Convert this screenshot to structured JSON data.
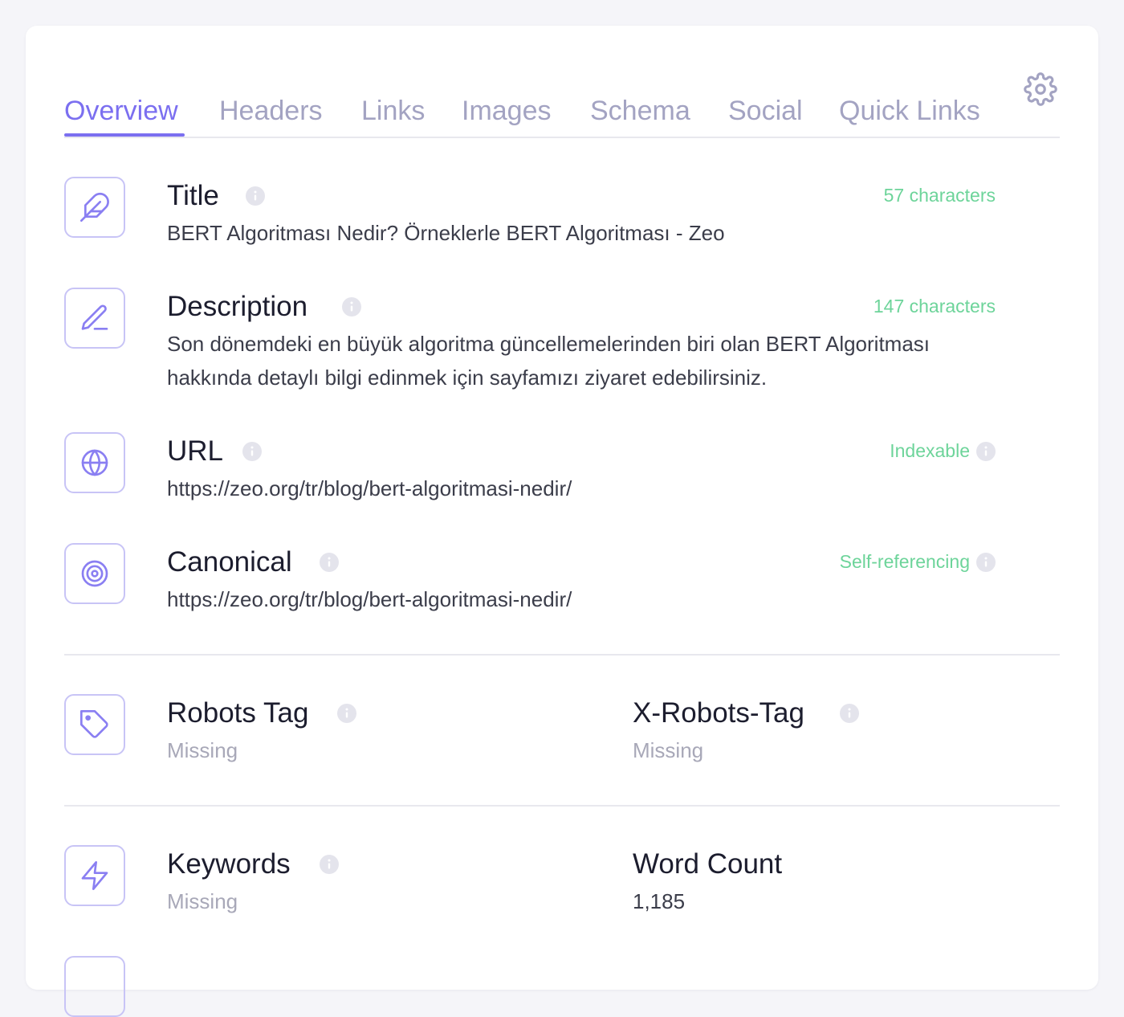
{
  "tabs": [
    {
      "label": "Overview",
      "active": true
    },
    {
      "label": "Headers"
    },
    {
      "label": "Links"
    },
    {
      "label": "Images"
    },
    {
      "label": "Schema"
    },
    {
      "label": "Social"
    },
    {
      "label": "Quick Links"
    }
  ],
  "settings_icon": "gear-icon",
  "colors": {
    "accent": "#7b6ff0",
    "tab_inactive": "#a3a3c2",
    "status_ok": "#6dd49a",
    "muted": "#a8a8b8"
  },
  "rows": {
    "title": {
      "label": "Title",
      "status": "57 characters",
      "value": "BERT Algoritması Nedir? Örneklerle BERT Algoritması - Zeo",
      "icon": "feather-icon"
    },
    "description": {
      "label": "Description",
      "status": "147 characters",
      "value": "Son dönemdeki en büyük algoritma güncellemelerinden biri olan BERT Algoritması hakkında detaylı bilgi edinmek için sayfamızı ziyaret edebilirsiniz.",
      "icon": "pencil-icon"
    },
    "url": {
      "label": "URL",
      "status": "Indexable",
      "value": "https://zeo.org/tr/blog/bert-algoritmasi-nedir/",
      "icon": "globe-icon"
    },
    "canonical": {
      "label": "Canonical",
      "status": "Self-referencing",
      "value": "https://zeo.org/tr/blog/bert-algoritmasi-nedir/",
      "icon": "target-icon"
    }
  },
  "robots": {
    "robots_tag": {
      "label": "Robots Tag",
      "value": "Missing",
      "icon": "tag-icon"
    },
    "x_robots_tag": {
      "label": "X-Robots-Tag",
      "value": "Missing"
    }
  },
  "meta": {
    "keywords": {
      "label": "Keywords",
      "value": "Missing",
      "icon": "lightning-icon"
    },
    "word_count": {
      "label": "Word Count",
      "value": "1,185"
    }
  }
}
